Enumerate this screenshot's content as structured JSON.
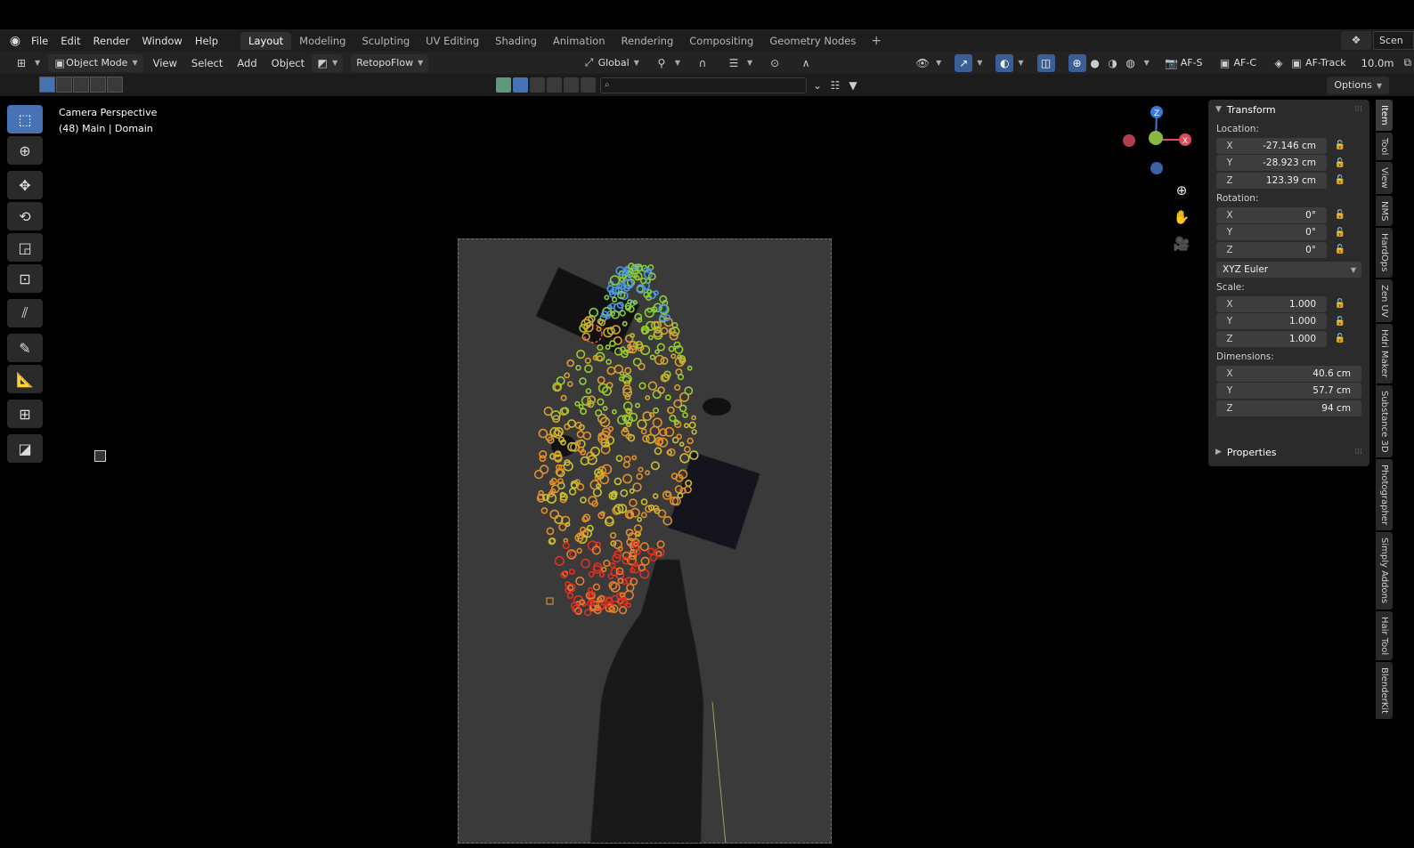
{
  "menubar": {
    "items": [
      "File",
      "Edit",
      "Render",
      "Window",
      "Help"
    ],
    "workspaces": [
      "Layout",
      "Modeling",
      "Sculpting",
      "UV Editing",
      "Shading",
      "Animation",
      "Rendering",
      "Compositing",
      "Geometry Nodes"
    ],
    "active_workspace": "Layout",
    "add_tab": "+",
    "scene_label": "Scen"
  },
  "header": {
    "mode": "Object Mode",
    "menus": [
      "View",
      "Select",
      "Add",
      "Object"
    ],
    "addon": "RetopoFlow",
    "orientation": "Global",
    "af_s": "AF-S",
    "af_c": "AF-C",
    "af_track": "AF-Track",
    "distance": "10.0m"
  },
  "subbar": {
    "options": "Options"
  },
  "viewport": {
    "line1": "Camera Perspective",
    "line2": "(48) Main | Domain"
  },
  "gizmo": {
    "x": "X",
    "z": "Z",
    "colors": {
      "x": "#e04a5a",
      "y": "#8ab840",
      "z": "#3c78d8",
      "neg_x": "#b04050",
      "neg_z": "#3a62a8"
    }
  },
  "npanel": {
    "title": "Transform",
    "location_label": "Location:",
    "location": [
      {
        "axis": "X",
        "value": "-27.146 cm"
      },
      {
        "axis": "Y",
        "value": "-28.923 cm"
      },
      {
        "axis": "Z",
        "value": "123.39 cm"
      }
    ],
    "rotation_label": "Rotation:",
    "rotation": [
      {
        "axis": "X",
        "value": "0°"
      },
      {
        "axis": "Y",
        "value": "0°"
      },
      {
        "axis": "Z",
        "value": "0°"
      }
    ],
    "rotation_mode": "XYZ Euler",
    "scale_label": "Scale:",
    "scale": [
      {
        "axis": "X",
        "value": "1.000"
      },
      {
        "axis": "Y",
        "value": "1.000"
      },
      {
        "axis": "Z",
        "value": "1.000"
      }
    ],
    "dimensions_label": "Dimensions:",
    "dimensions": [
      {
        "axis": "X",
        "value": "40.6 cm"
      },
      {
        "axis": "Y",
        "value": "57.7 cm"
      },
      {
        "axis": "Z",
        "value": "94 cm"
      }
    ],
    "properties_title": "Properties"
  },
  "side_tabs": [
    "Item",
    "Tool",
    "View",
    "NMS",
    "HardOps",
    "Zen UV",
    "Hdri Maker",
    "Substance 3D",
    "Photographer",
    "Simply Addons",
    "Hair Tool",
    "BlenderKit"
  ],
  "accent_color": "#4772b3"
}
